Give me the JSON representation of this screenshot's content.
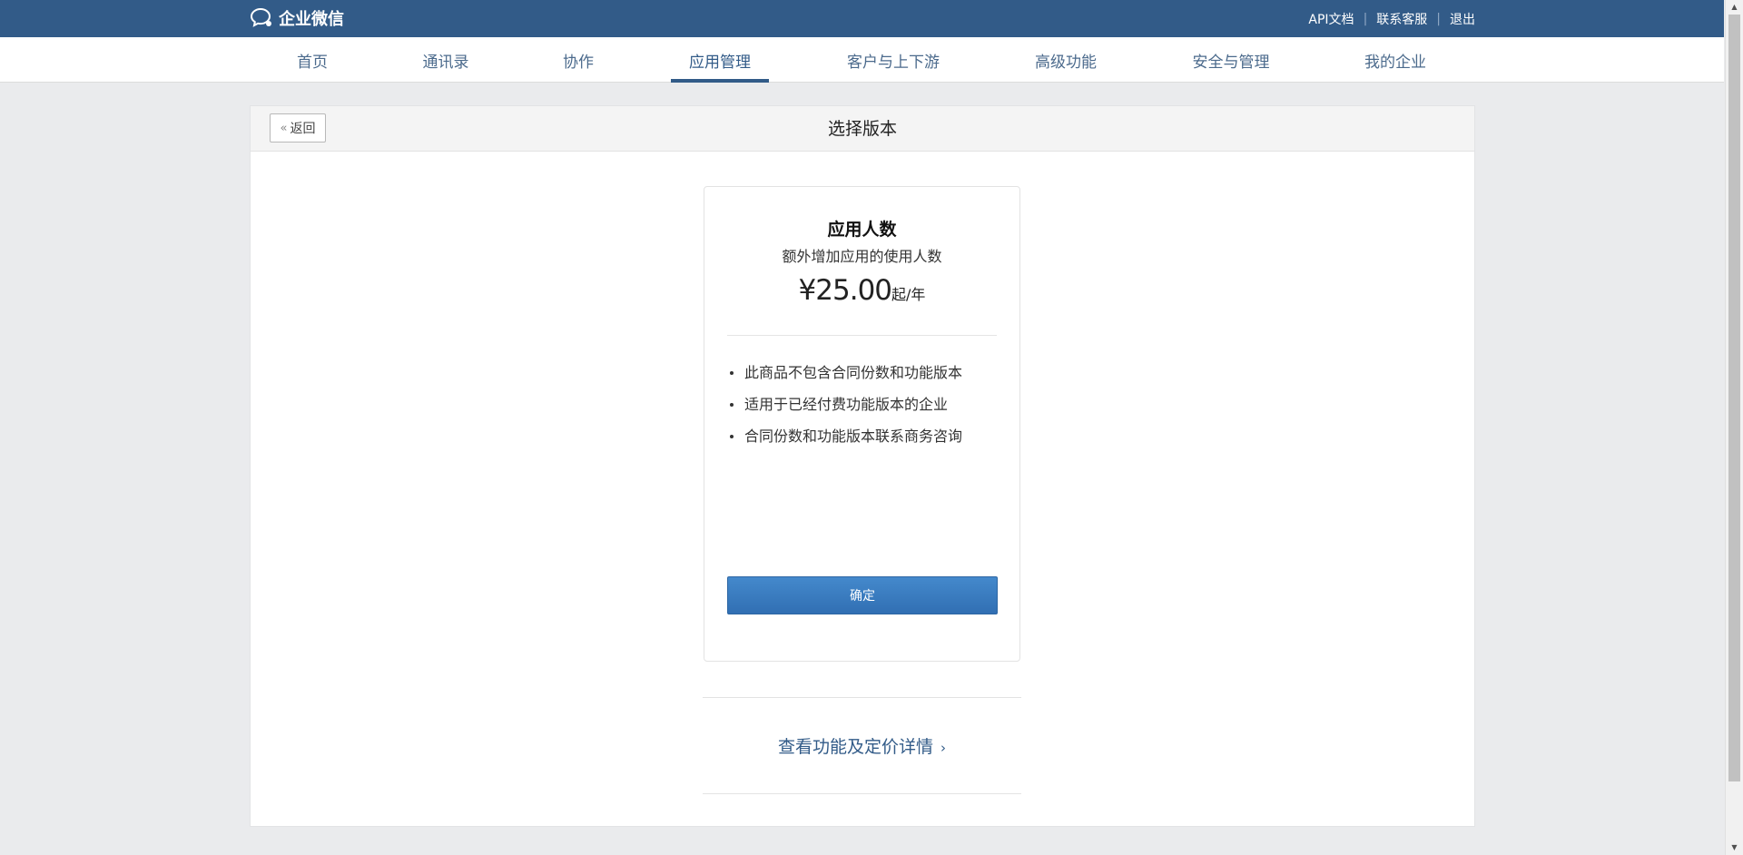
{
  "header": {
    "logo_text": "企业微信",
    "links": [
      {
        "label": "API文档"
      },
      {
        "label": "联系客服"
      },
      {
        "label": "退出"
      }
    ]
  },
  "nav": {
    "items": [
      {
        "label": "首页"
      },
      {
        "label": "通讯录"
      },
      {
        "label": "协作"
      },
      {
        "label": "应用管理",
        "active": true
      },
      {
        "label": "客户与上下游"
      },
      {
        "label": "高级功能"
      },
      {
        "label": "安全与管理"
      },
      {
        "label": "我的企业"
      }
    ]
  },
  "panel": {
    "back_label": "返回",
    "title": "选择版本"
  },
  "card": {
    "title": "应用人数",
    "subtitle": "额外增加应用的使用人数",
    "price_amount": "¥25.00",
    "price_unit": "起/年",
    "features": [
      "此商品不包含合同份数和功能版本",
      "适用于已经付费功能版本的企业",
      "合同份数和功能版本联系商务咨询"
    ],
    "confirm_label": "确定"
  },
  "details_link": "查看功能及定价详情",
  "colors": {
    "header_bg": "#325b88",
    "accent": "#325b88",
    "button_bg": "#3a7dc2",
    "page_bg": "#eaebed"
  }
}
